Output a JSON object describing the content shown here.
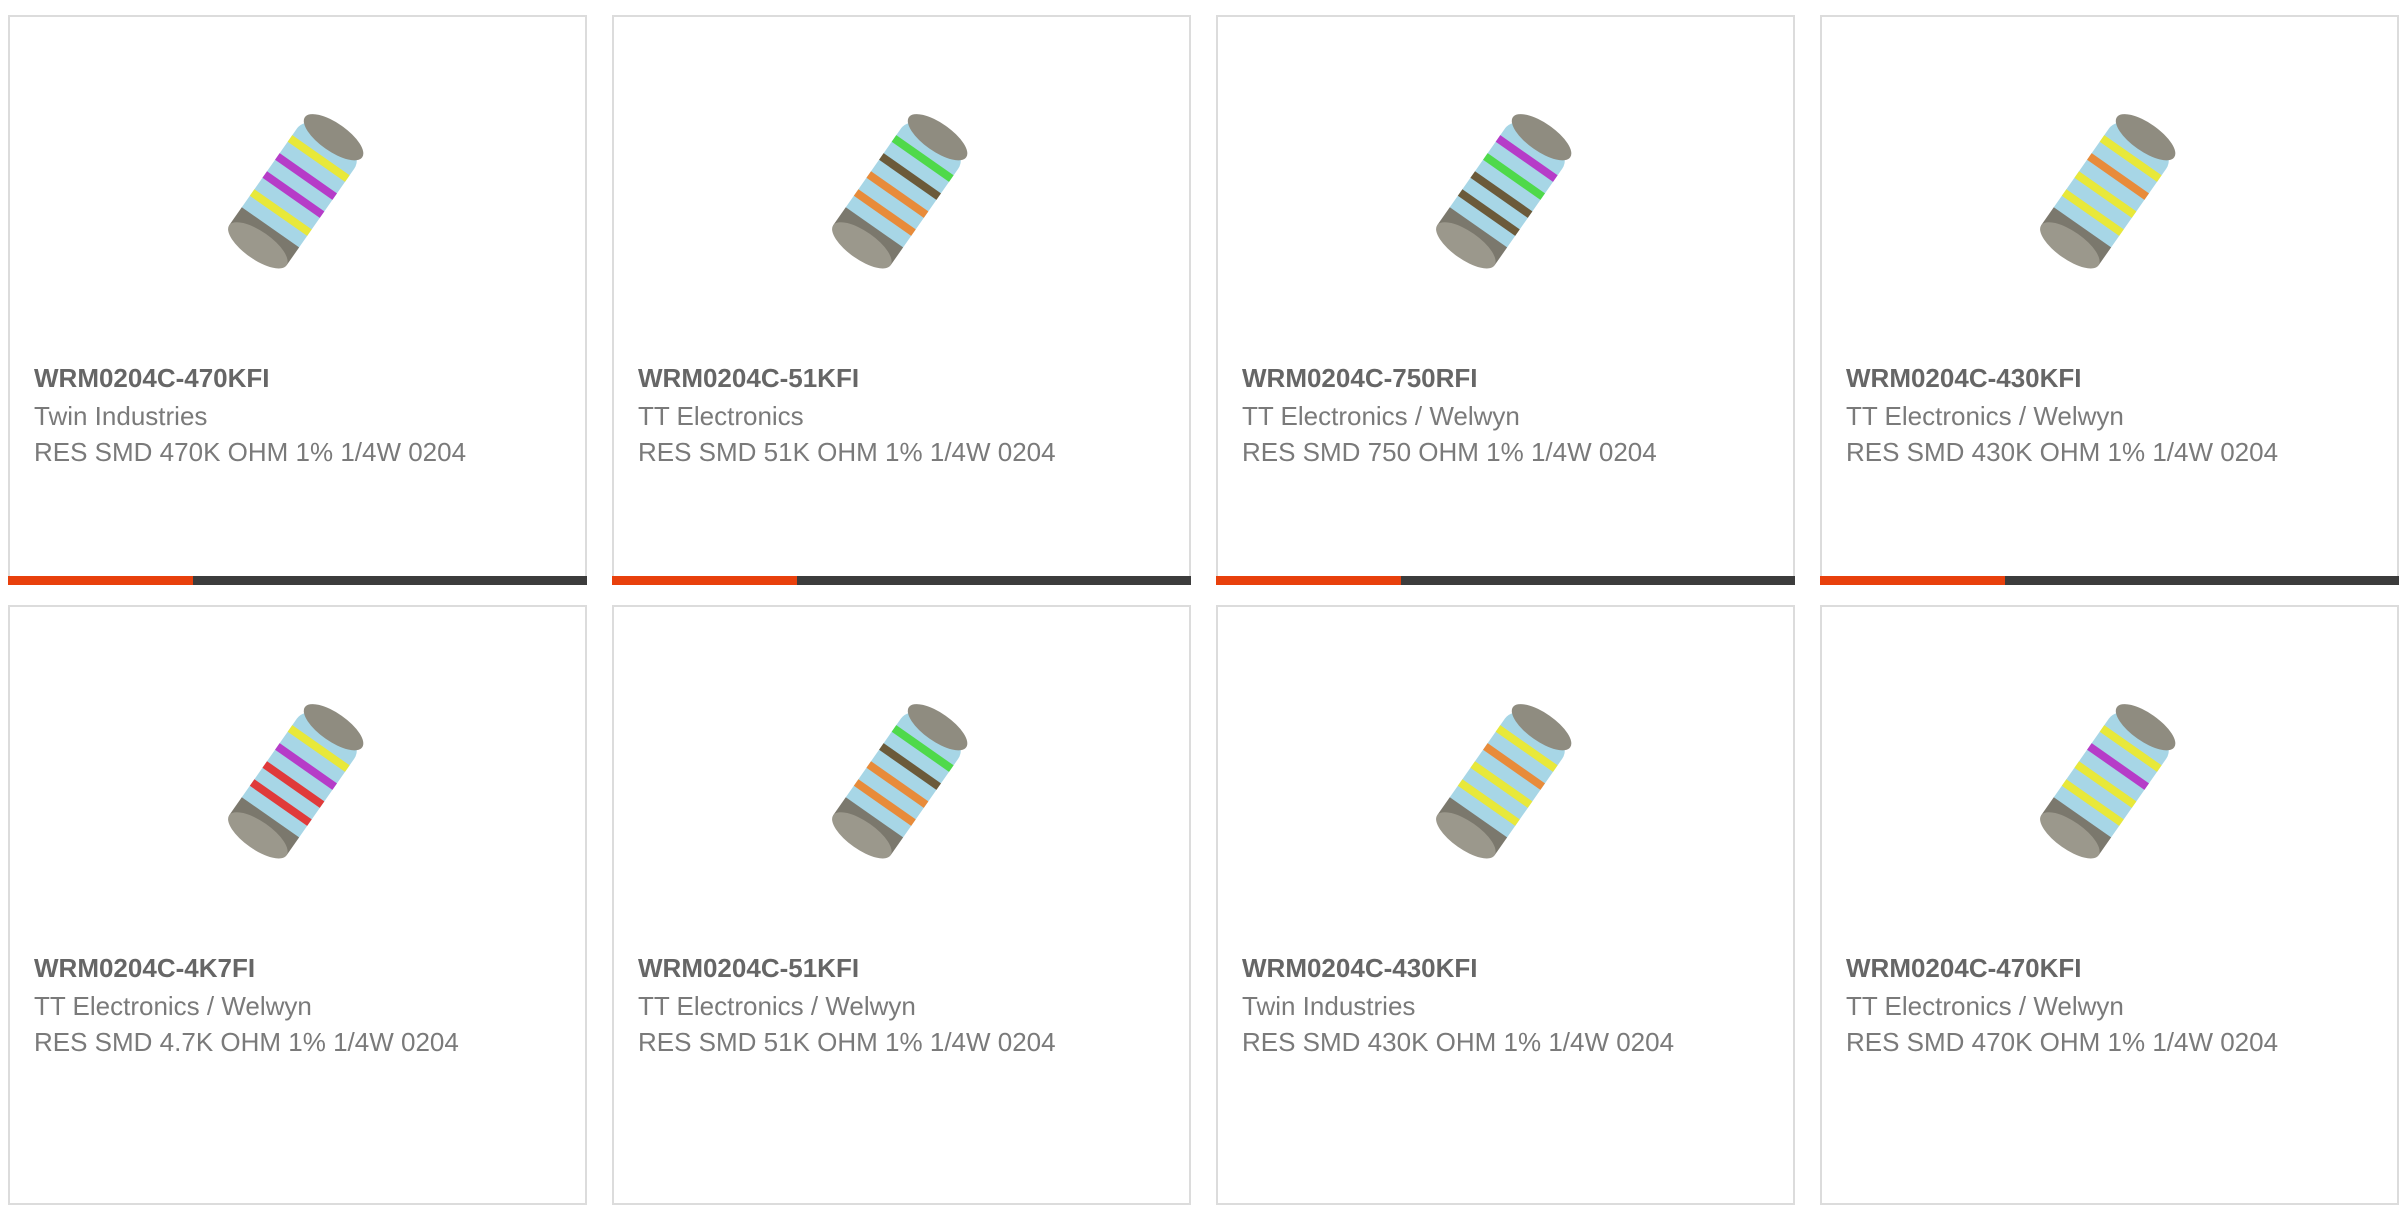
{
  "products": [
    {
      "part_number": "WRM0204C-470KFI",
      "manufacturer": "Twin Industries",
      "description": "RES SMD 470K OHM 1% 1/4W 0204",
      "image_icon": "resistor-image",
      "bands": [
        "#e8e83a",
        "#b63cc8",
        "#b63cc8",
        "#e8e83a"
      ],
      "progress": 0.32
    },
    {
      "part_number": "WRM0204C-51KFI",
      "manufacturer": "TT Electronics",
      "description": "RES SMD 51K OHM 1% 1/4W 0204",
      "image_icon": "resistor-image",
      "bands": [
        "#4fd94a",
        "#6b5a3a",
        "#e88b3a",
        "#e88b3a"
      ],
      "progress": 0.32
    },
    {
      "part_number": "WRM0204C-750RFI",
      "manufacturer": "TT Electronics / Welwyn",
      "description": "RES SMD 750 OHM 1% 1/4W 0204",
      "image_icon": "resistor-image",
      "bands": [
        "#b63cc8",
        "#4fd94a",
        "#6b5a3a",
        "#6b5a3a"
      ],
      "progress": 0.32
    },
    {
      "part_number": "WRM0204C-430KFI",
      "manufacturer": "TT Electronics / Welwyn",
      "description": "RES SMD 430K OHM 1% 1/4W 0204",
      "image_icon": "resistor-image",
      "bands": [
        "#e8e83a",
        "#e88b3a",
        "#e8e83a",
        "#e8e83a"
      ],
      "progress": 0.32
    },
    {
      "part_number": "WRM0204C-4K7FI",
      "manufacturer": "TT Electronics / Welwyn",
      "description": "RES SMD 4.7K OHM 1% 1/4W 0204",
      "image_icon": "resistor-image",
      "bands": [
        "#e8e83a",
        "#b63cc8",
        "#e03a3a",
        "#e03a3a"
      ],
      "progress": null
    },
    {
      "part_number": "WRM0204C-51KFI",
      "manufacturer": "TT Electronics / Welwyn",
      "description": "RES SMD 51K OHM 1% 1/4W 0204",
      "image_icon": "resistor-image",
      "bands": [
        "#4fd94a",
        "#6b5a3a",
        "#e88b3a",
        "#e88b3a"
      ],
      "progress": null
    },
    {
      "part_number": "WRM0204C-430KFI",
      "manufacturer": "Twin Industries",
      "description": "RES SMD 430K OHM 1% 1/4W 0204",
      "image_icon": "resistor-image",
      "bands": [
        "#e8e83a",
        "#e88b3a",
        "#e8e83a",
        "#e8e83a"
      ],
      "progress": null
    },
    {
      "part_number": "WRM0204C-470KFI",
      "manufacturer": "TT Electronics / Welwyn",
      "description": "RES SMD 470K OHM 1% 1/4W 0204",
      "image_icon": "resistor-image",
      "bands": [
        "#e8e83a",
        "#b63cc8",
        "#e8e83a",
        "#e8e83a"
      ],
      "progress": null
    }
  ],
  "colors": {
    "progress_accent": "#e8400c",
    "progress_track": "#3c3c3c",
    "body_color": "#a7d6e6",
    "cap_color": "#8f8c80"
  }
}
